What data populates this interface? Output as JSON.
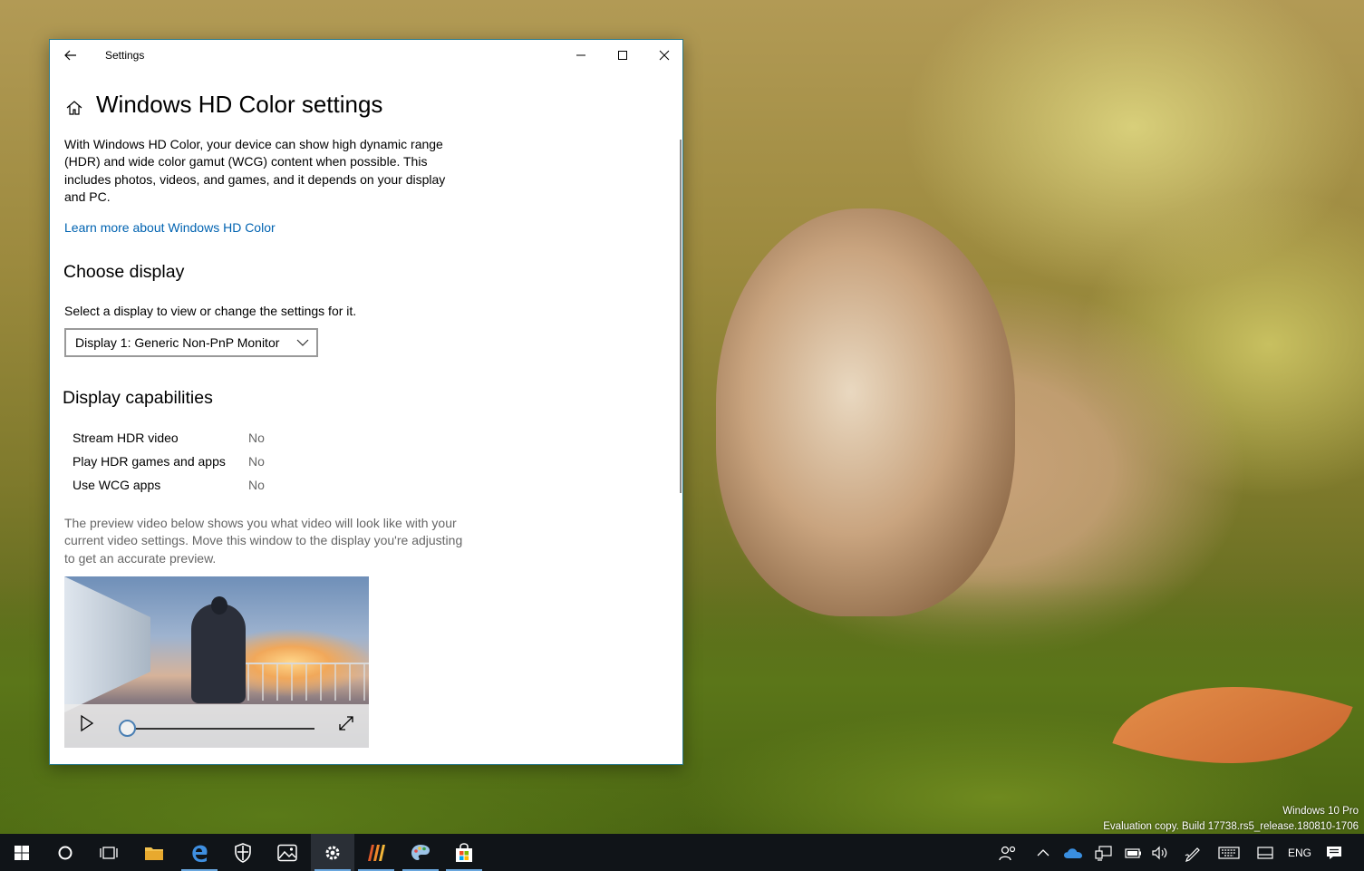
{
  "window": {
    "title": "Settings",
    "page_title": "Windows HD Color settings",
    "intro": "With Windows HD Color, your device can show high dynamic range (HDR) and wide color gamut (WCG) content when possible. This includes photos, videos, and games, and it depends on your display and PC.",
    "learn_more_link": "Learn more about Windows HD Color",
    "choose_display_heading": "Choose display",
    "select_display_label": "Select a display to view or change the settings for it.",
    "display_dropdown_value": "Display 1: Generic Non-PnP Monitor",
    "capabilities_heading": "Display capabilities",
    "capabilities": [
      {
        "name": "Stream HDR video",
        "value": "No"
      },
      {
        "name": "Play HDR games and apps",
        "value": "No"
      },
      {
        "name": "Use WCG apps",
        "value": "No"
      }
    ],
    "preview_note": "The preview video below shows you what video will look like with your current video settings. Move this window to the display you're adjusting to get an accurate preview.",
    "video_progress": 0.0
  },
  "desktop": {
    "watermark_line1": "Windows 10 Pro",
    "watermark_line2": "Evaluation copy. Build 17738.rs5_release.180810-1706"
  },
  "taskbar": {
    "apps": [
      "windows-start-icon",
      "cortana-icon",
      "task-view-icon",
      "file-explorer-icon",
      "edge-icon",
      "windows-security-icon",
      "photos-icon",
      "settings-icon",
      "app-icon",
      "paint-icon",
      "store-icon"
    ],
    "language": "ENG"
  },
  "colors": {
    "accent": "#0063b1",
    "window_border": "#2b7a8a",
    "taskbar": "#101418"
  }
}
